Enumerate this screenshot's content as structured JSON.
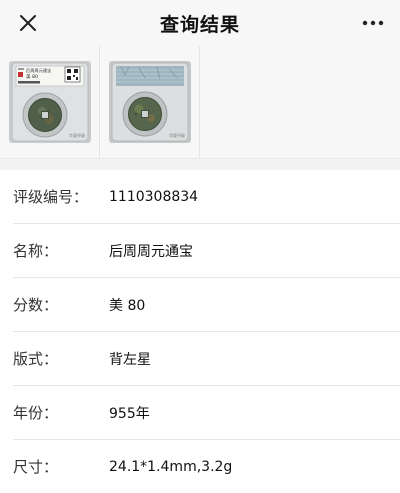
{
  "header": {
    "title": "查询结果",
    "close_icon": "close-icon",
    "more_icon": "more-icon"
  },
  "gallery": {
    "images": [
      {
        "name": "slab-front",
        "tag_grade_text": "美 80",
        "tag_name_text": "后周周元通宝",
        "watermark": "华夏评级"
      },
      {
        "name": "slab-back",
        "watermark": "华夏评级"
      }
    ]
  },
  "details": {
    "rows": [
      {
        "label": "评级编号：",
        "value": "1110308834"
      },
      {
        "label": "名称：",
        "value": "后周周元通宝"
      },
      {
        "label": "分数：",
        "value": "美 80"
      },
      {
        "label": "版式：",
        "value": "背左星"
      },
      {
        "label": "年份：",
        "value": "955年"
      },
      {
        "label": "尺寸：",
        "value": "24.1*1.4mm,3.2g"
      }
    ]
  },
  "colors": {
    "nav_bg": "#f7f7f7",
    "divider": "#e6e6e6",
    "coin": "#4f5f4a"
  }
}
